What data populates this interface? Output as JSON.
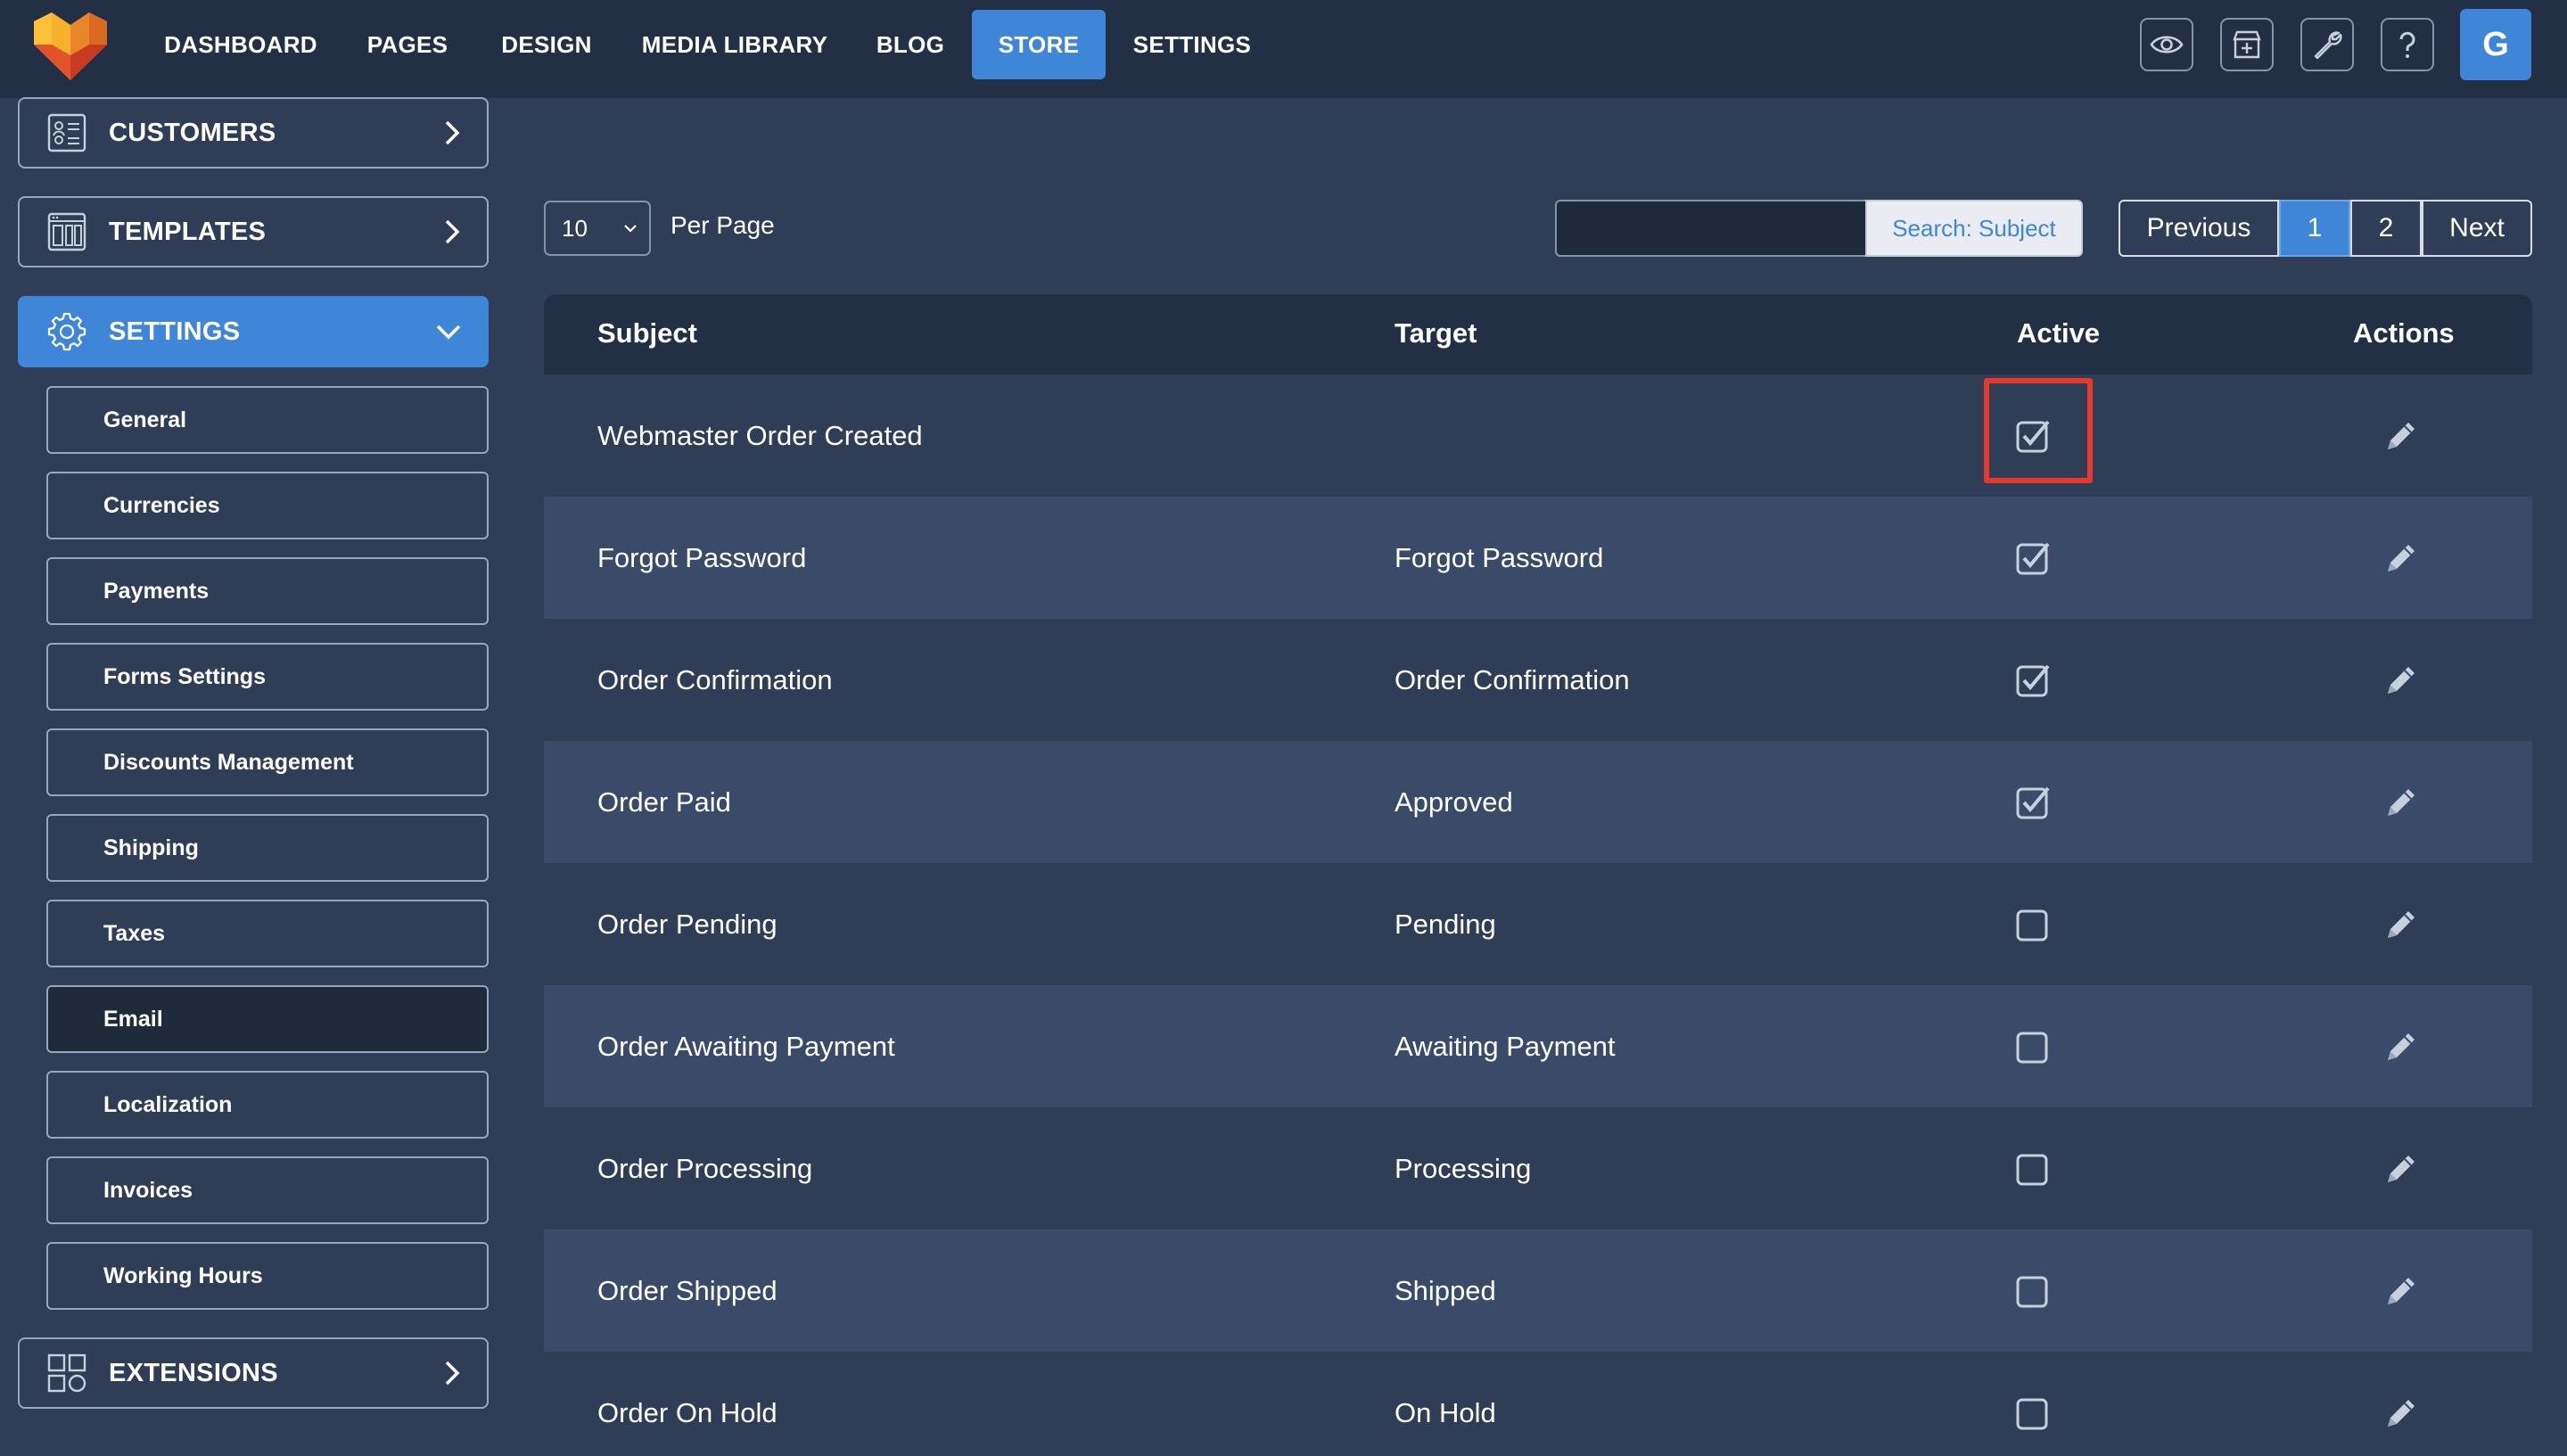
{
  "topnav": {
    "items": [
      "DASHBOARD",
      "PAGES",
      "DESIGN",
      "MEDIA LIBRARY",
      "BLOG",
      "STORE",
      "SETTINGS"
    ],
    "active": "STORE",
    "icons": [
      "eye-icon",
      "shop-add-icon",
      "wrench-icon",
      "help-icon"
    ],
    "avatar_letter": "G"
  },
  "sidebar": {
    "customers": "CUSTOMERS",
    "templates": "TEMPLATES",
    "settings": "SETTINGS",
    "extensions": "EXTENSIONS",
    "sub_items": [
      "General",
      "Currencies",
      "Payments",
      "Forms Settings",
      "Discounts Management",
      "Shipping",
      "Taxes",
      "Email",
      "Localization",
      "Invoices",
      "Working Hours"
    ],
    "selected_sub": "Email"
  },
  "controls": {
    "per_page_value": "10",
    "per_page_label": "Per Page",
    "search_value": "",
    "search_button": "Search: Subject",
    "pagination": {
      "previous": "Previous",
      "pages": [
        "1",
        "2"
      ],
      "current": "1",
      "next": "Next"
    }
  },
  "table": {
    "headers": {
      "subject": "Subject",
      "target": "Target",
      "active": "Active",
      "actions": "Actions"
    },
    "rows": [
      {
        "subject": "Webmaster Order Created",
        "target": "",
        "active": true
      },
      {
        "subject": "Forgot Password",
        "target": "Forgot Password",
        "active": true
      },
      {
        "subject": "Order Confirmation",
        "target": "Order Confirmation",
        "active": true
      },
      {
        "subject": "Order Paid",
        "target": "Approved",
        "active": true
      },
      {
        "subject": "Order Pending",
        "target": "Pending",
        "active": false
      },
      {
        "subject": "Order Awaiting Payment",
        "target": "Awaiting Payment",
        "active": false
      },
      {
        "subject": "Order Processing",
        "target": "Processing",
        "active": false
      },
      {
        "subject": "Order Shipped",
        "target": "Shipped",
        "active": false
      },
      {
        "subject": "Order On Hold",
        "target": "On Hold",
        "active": false
      }
    ]
  },
  "colors": {
    "accent": "#3f86d8",
    "topbar": "#232f44",
    "background": "#2f3d56",
    "row_alt": "#3a4a69",
    "highlight": "#e5392c"
  }
}
